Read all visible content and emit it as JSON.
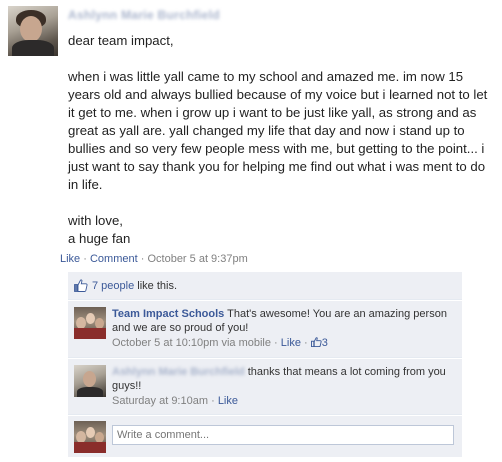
{
  "post": {
    "author": "Ashlynn Marie Burchfield",
    "message_paragraphs": [
      "dear team impact,",
      "when i was little yall came to my school and amazed me. im now 15 years old and always bullied because of my voice but i learned not to let it get to me. when i grow up i want to be just like yall, as strong and as great as yall are. yall changed my life that day and now i stand up to bullies and so very few people mess with me, but getting to the point... i just want to say thank you for helping me find out what i was ment to do in life.",
      "with love,\na huge fan"
    ],
    "actions": {
      "like": "Like",
      "separator": "·",
      "comment": "Comment",
      "timestamp": "October 5 at 9:37pm"
    }
  },
  "likes": {
    "icon": "thumbs-up-icon",
    "count_text": "7 people",
    "suffix": " like this."
  },
  "comments": [
    {
      "author": "Team Impact Schools",
      "text": "That's awesome! You are an amazing person and we are so proud of you!",
      "timestamp": "October 5 at 10:10pm via mobile",
      "like_label": "Like",
      "like_count": "3"
    },
    {
      "author": "Ashlynn Marie Burchfield",
      "text": "thanks that means a lot coming from you guys!!",
      "timestamp": "Saturday at 9:10am",
      "like_label": "Like"
    }
  ],
  "composer": {
    "placeholder": "Write a comment..."
  },
  "colors": {
    "link": "#3b5998",
    "ufi_background": "#edeff4",
    "meta_text": "#808080"
  }
}
